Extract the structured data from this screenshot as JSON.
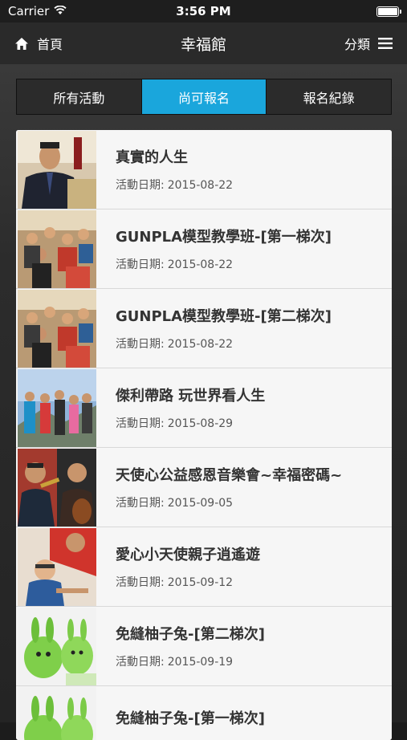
{
  "status": {
    "carrier": "Carrier",
    "time": "3:56 PM"
  },
  "nav": {
    "back_label": "首頁",
    "title": "幸福館",
    "category_label": "分類"
  },
  "tabs": [
    {
      "label": "所有活動",
      "active": false
    },
    {
      "label": "尚可報名",
      "active": true
    },
    {
      "label": "報名紀錄",
      "active": false
    }
  ],
  "colors": {
    "accent": "#1aa6dc"
  },
  "list": {
    "date_label": "活動日期:",
    "items": [
      {
        "title": "真實的人生",
        "date": "2015-08-22",
        "thumb": "portrait-man-photo"
      },
      {
        "title": "GUNPLA模型教學班-[第一梯次]",
        "date": "2015-08-22",
        "thumb": "classroom-group-photo"
      },
      {
        "title": "GUNPLA模型教學班-[第二梯次]",
        "date": "2015-08-22",
        "thumb": "classroom-group-photo"
      },
      {
        "title": "傑利帶路 玩世界看人生",
        "date": "2015-08-29",
        "thumb": "travel-group-photo"
      },
      {
        "title": "天使心公益感恩音樂會~幸福密碼~",
        "date": "2015-09-05",
        "thumb": "musicians-photo"
      },
      {
        "title": "愛心小天使親子逍遙遊",
        "date": "2015-09-12",
        "thumb": "parent-child-photo"
      },
      {
        "title": "免縫柚子兔-[第二梯次]",
        "date": "2015-09-19",
        "thumb": "green-rabbit-photo"
      },
      {
        "title": "免縫柚子兔-[第一梯次]",
        "date": "",
        "thumb": "green-rabbit-photo"
      }
    ]
  }
}
